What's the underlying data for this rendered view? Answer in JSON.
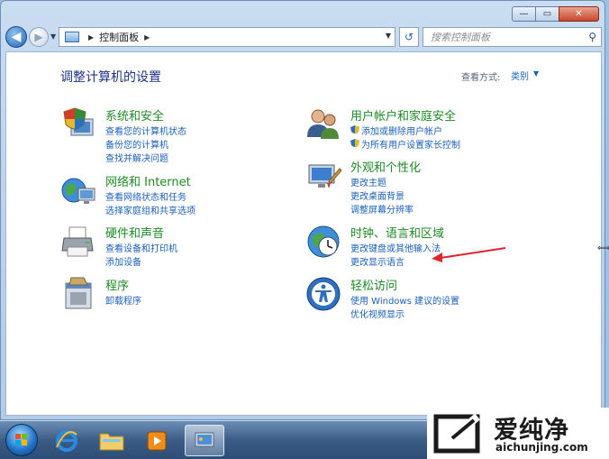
{
  "window": {
    "caption_min": "—",
    "caption_max": "▭",
    "caption_close": "✕"
  },
  "nav": {
    "back": "◀",
    "forward": "▶",
    "history_dropdown": "▼",
    "address_segment": "控制面板",
    "address_dropdown": "▼",
    "refresh": "↺",
    "search_placeholder": "搜索控制面板",
    "search_icon": "⚲"
  },
  "content": {
    "title": "调整计算机的设置",
    "view_by_label": "查看方式:",
    "view_by_value": "类别",
    "view_by_dropdown": "▼"
  },
  "categories": [
    {
      "title": "系统和安全",
      "icon": "shield-computer-icon",
      "links": [
        "查看您的计算机状态",
        "备份您的计算机",
        "查找并解决问题"
      ]
    },
    {
      "title": "网络和 Internet",
      "icon": "network-globe-icon",
      "links": [
        "查看网络状态和任务",
        "选择家庭组和共享选项"
      ]
    },
    {
      "title": "硬件和声音",
      "icon": "printer-icon",
      "links": [
        "查看设备和打印机",
        "添加设备"
      ]
    },
    {
      "title": "程序",
      "icon": "programs-icon",
      "links": [
        "卸载程序"
      ]
    },
    {
      "title": "用户帐户和家庭安全",
      "icon": "users-icon",
      "links": [
        "添加或删除用户帐户",
        "为所有用户设置家长控制"
      ]
    },
    {
      "title": "外观和个性化",
      "icon": "monitor-brush-icon",
      "links": [
        "更改主题",
        "更改桌面背景",
        "调整屏幕分辨率"
      ]
    },
    {
      "title": "时钟、语言和区域",
      "icon": "clock-globe-icon",
      "links": [
        "更改键盘或其他输入法",
        "更改显示语言"
      ]
    },
    {
      "title": "轻松访问",
      "icon": "ease-of-access-icon",
      "links": [
        "使用 Windows 建议的设置",
        "优化视频显示"
      ]
    }
  ],
  "watermark": {
    "name_cn": "爱纯净",
    "domain": "aichunjing.com"
  },
  "colors": {
    "category_title": "#1e8a25",
    "link": "#1a5fbd",
    "page_title": "#1e3287",
    "arrow": "#e0242b"
  }
}
